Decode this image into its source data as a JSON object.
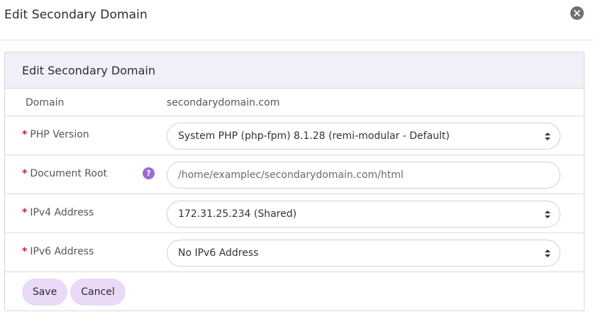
{
  "modal": {
    "title": "Edit Secondary Domain"
  },
  "panel": {
    "title": "Edit Secondary Domain"
  },
  "form": {
    "domain": {
      "label": "Domain",
      "value": "secondarydomain.com"
    },
    "php_version": {
      "label": "PHP Version",
      "value": "System PHP (php-fpm) 8.1.28 (remi-modular - Default)"
    },
    "document_root": {
      "label": "Document Root",
      "value": "/home/examplec/secondarydomain.com/html",
      "help": "?"
    },
    "ipv4": {
      "label": "IPv4 Address",
      "value": "172.31.25.234 (Shared)"
    },
    "ipv6": {
      "label": "IPv6 Address",
      "value": "No IPv6 Address"
    },
    "required_marker": "*"
  },
  "buttons": {
    "save": "Save",
    "cancel": "Cancel"
  },
  "colors": {
    "accent": "#ead9f7",
    "heading_bg": "#f3eff8",
    "required": "#c0262d",
    "help_icon": "#9a6cd6"
  },
  "icons": {
    "close": "close-circle-icon",
    "help": "question-circle-icon",
    "select_caret": "sort-caret-icon"
  }
}
